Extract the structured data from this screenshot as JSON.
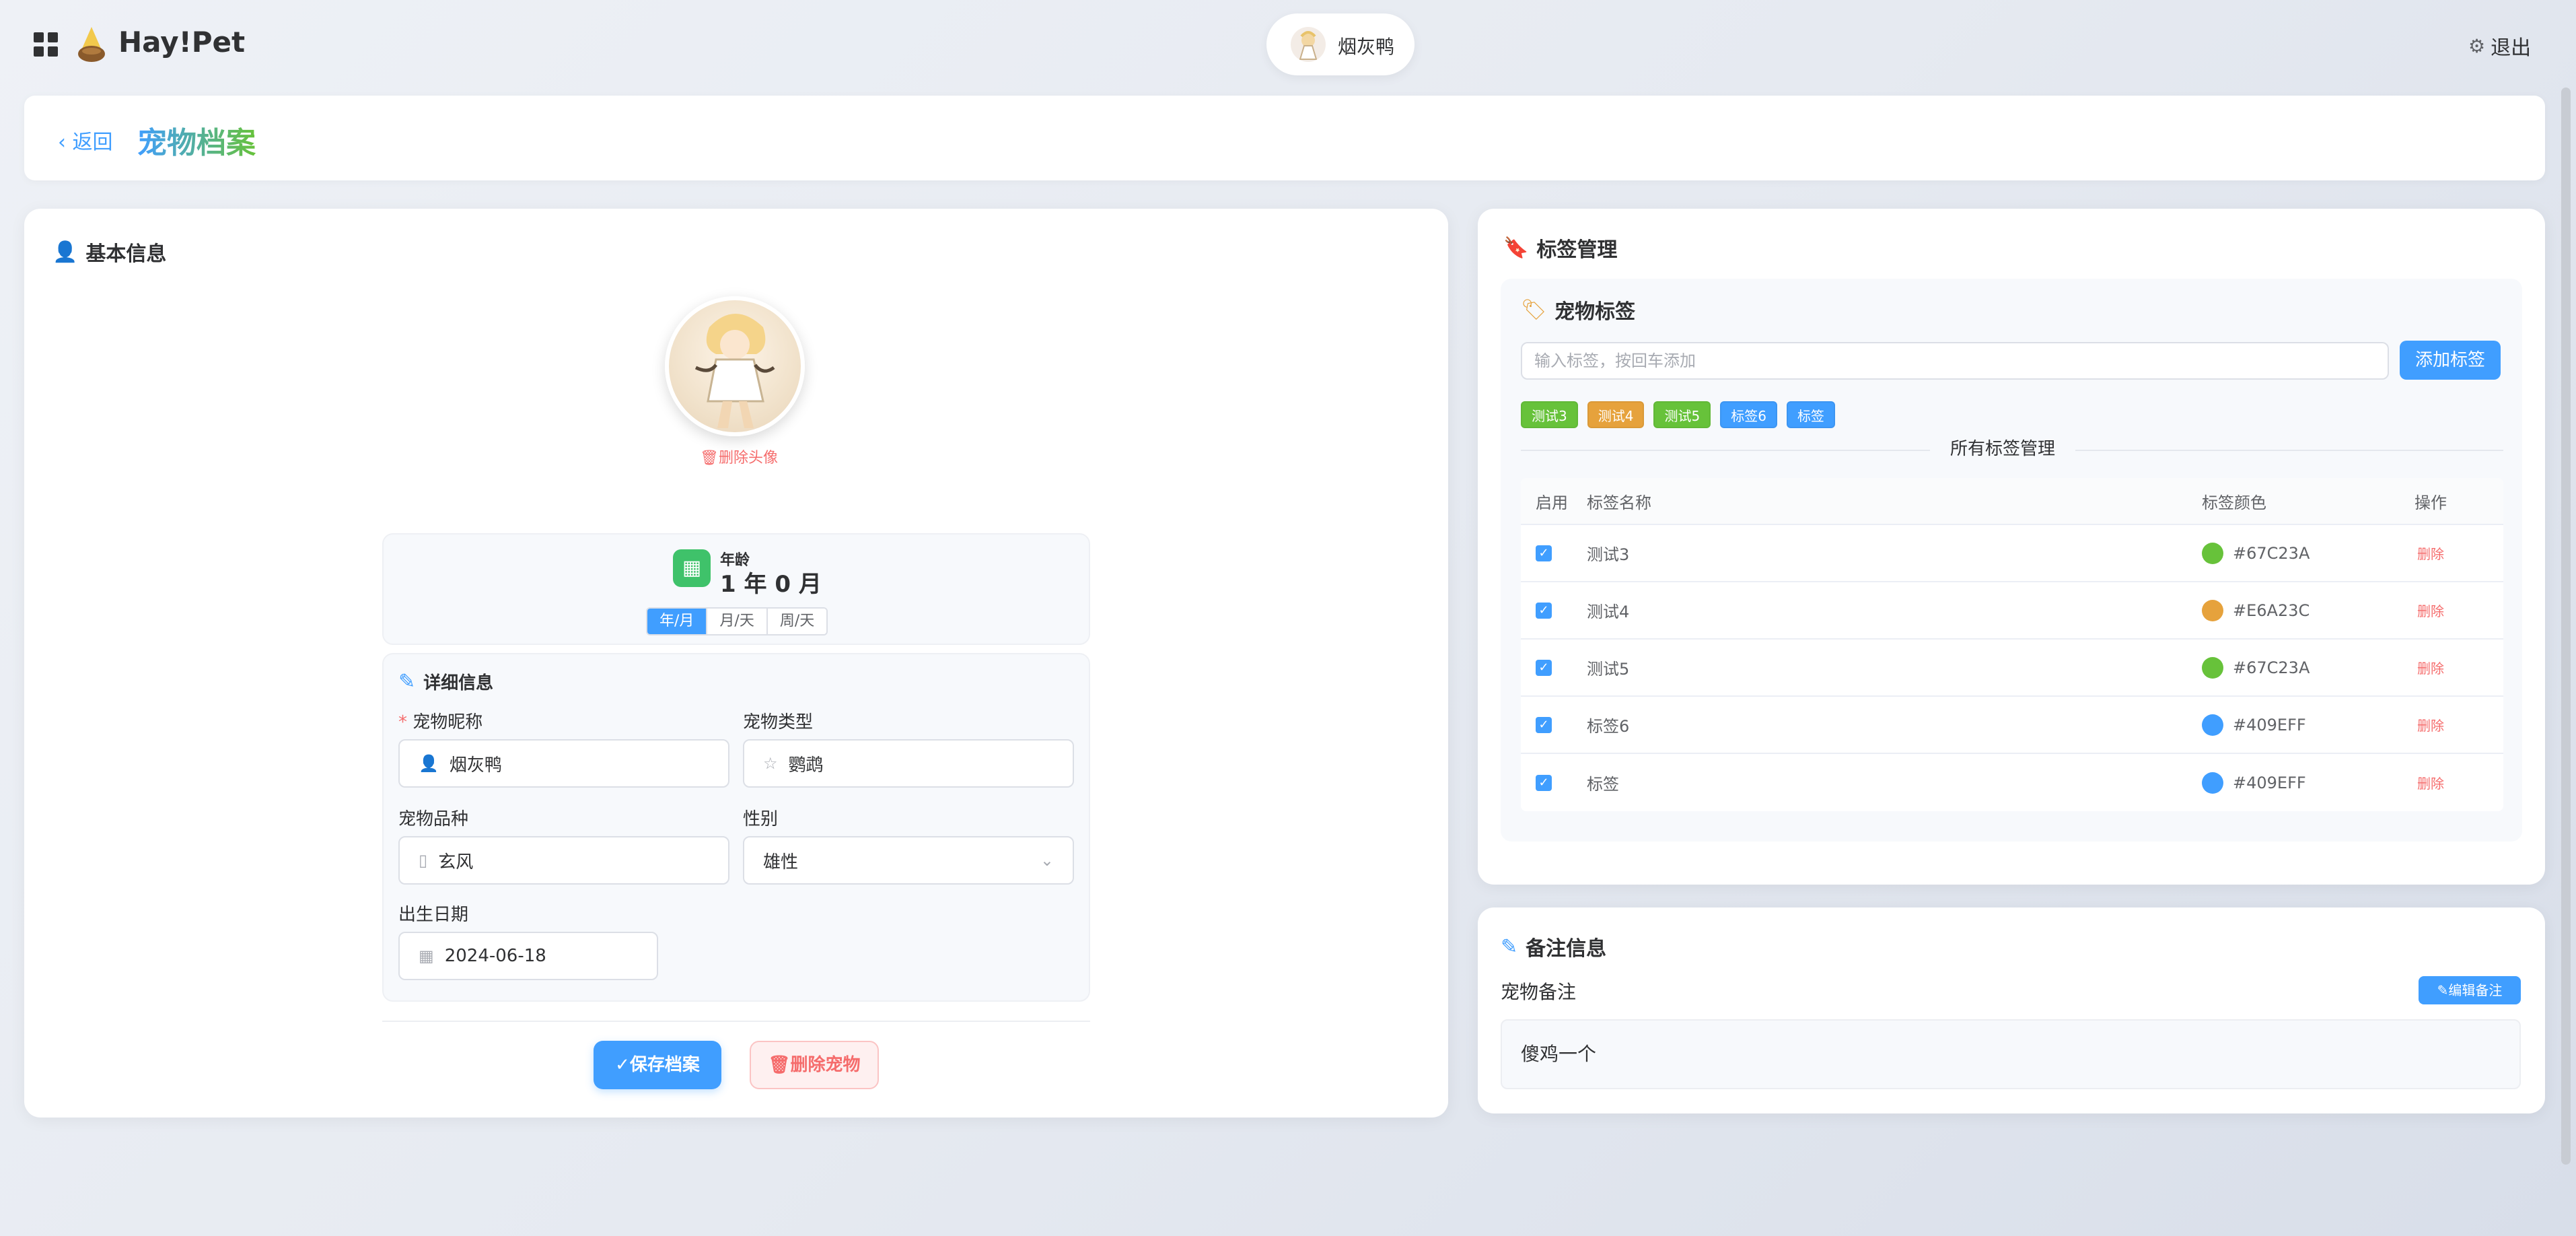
{
  "app": {
    "brand": "Hay!Pet",
    "user_name": "烟灰鸭",
    "logout_label": "退出"
  },
  "header": {
    "back_label": "返回",
    "title": "宠物档案"
  },
  "basic_info": {
    "title": "基本信息",
    "delete_avatar_label": "删除头像",
    "age": {
      "label": "年龄",
      "value": "1 年 0 月",
      "modes": [
        "年/月",
        "月/天",
        "周/天"
      ],
      "active_mode": "年/月"
    },
    "details": {
      "title": "详细信息",
      "nickname_label": "宠物昵称",
      "nickname_value": "烟灰鸭",
      "type_label": "宠物类型",
      "type_value": "鹦鹉",
      "breed_label": "宠物品种",
      "breed_value": "玄风",
      "gender_label": "性别",
      "gender_value": "雄性",
      "birthday_label": "出生日期",
      "birthday_value": "2024-06-18"
    },
    "save_label": "保存档案",
    "delete_label": "删除宠物"
  },
  "tags": {
    "title": "标签管理",
    "section_title": "宠物标签",
    "input_placeholder": "输入标签，按回车添加",
    "add_label": "添加标签",
    "chips": [
      {
        "label": "测试3",
        "color": "#67C23A"
      },
      {
        "label": "测试4",
        "color": "#E6A23C"
      },
      {
        "label": "测试5",
        "color": "#67C23A"
      },
      {
        "label": "标签6",
        "color": "#409EFF"
      },
      {
        "label": "标签",
        "color": "#409EFF"
      }
    ],
    "all_tags_label": "所有标签管理",
    "table": {
      "headers": [
        "启用",
        "标签名称",
        "标签颜色",
        "操作"
      ],
      "rows": [
        {
          "name": "测试3",
          "color": "#67C23A",
          "action": "删除"
        },
        {
          "name": "测试4",
          "color": "#E6A23C",
          "action": "删除"
        },
        {
          "name": "测试5",
          "color": "#67C23A",
          "action": "删除"
        },
        {
          "name": "标签6",
          "color": "#409EFF",
          "action": "删除"
        },
        {
          "name": "标签",
          "color": "#409EFF",
          "action": "删除"
        }
      ]
    }
  },
  "notes": {
    "title": "备注信息",
    "label": "宠物备注",
    "edit_label": "编辑备注",
    "content": "傻鸡一个"
  },
  "colors": {
    "accent": "#409EFF",
    "success": "#67C23A",
    "warning": "#E6A23C",
    "danger": "#F56C6C"
  }
}
